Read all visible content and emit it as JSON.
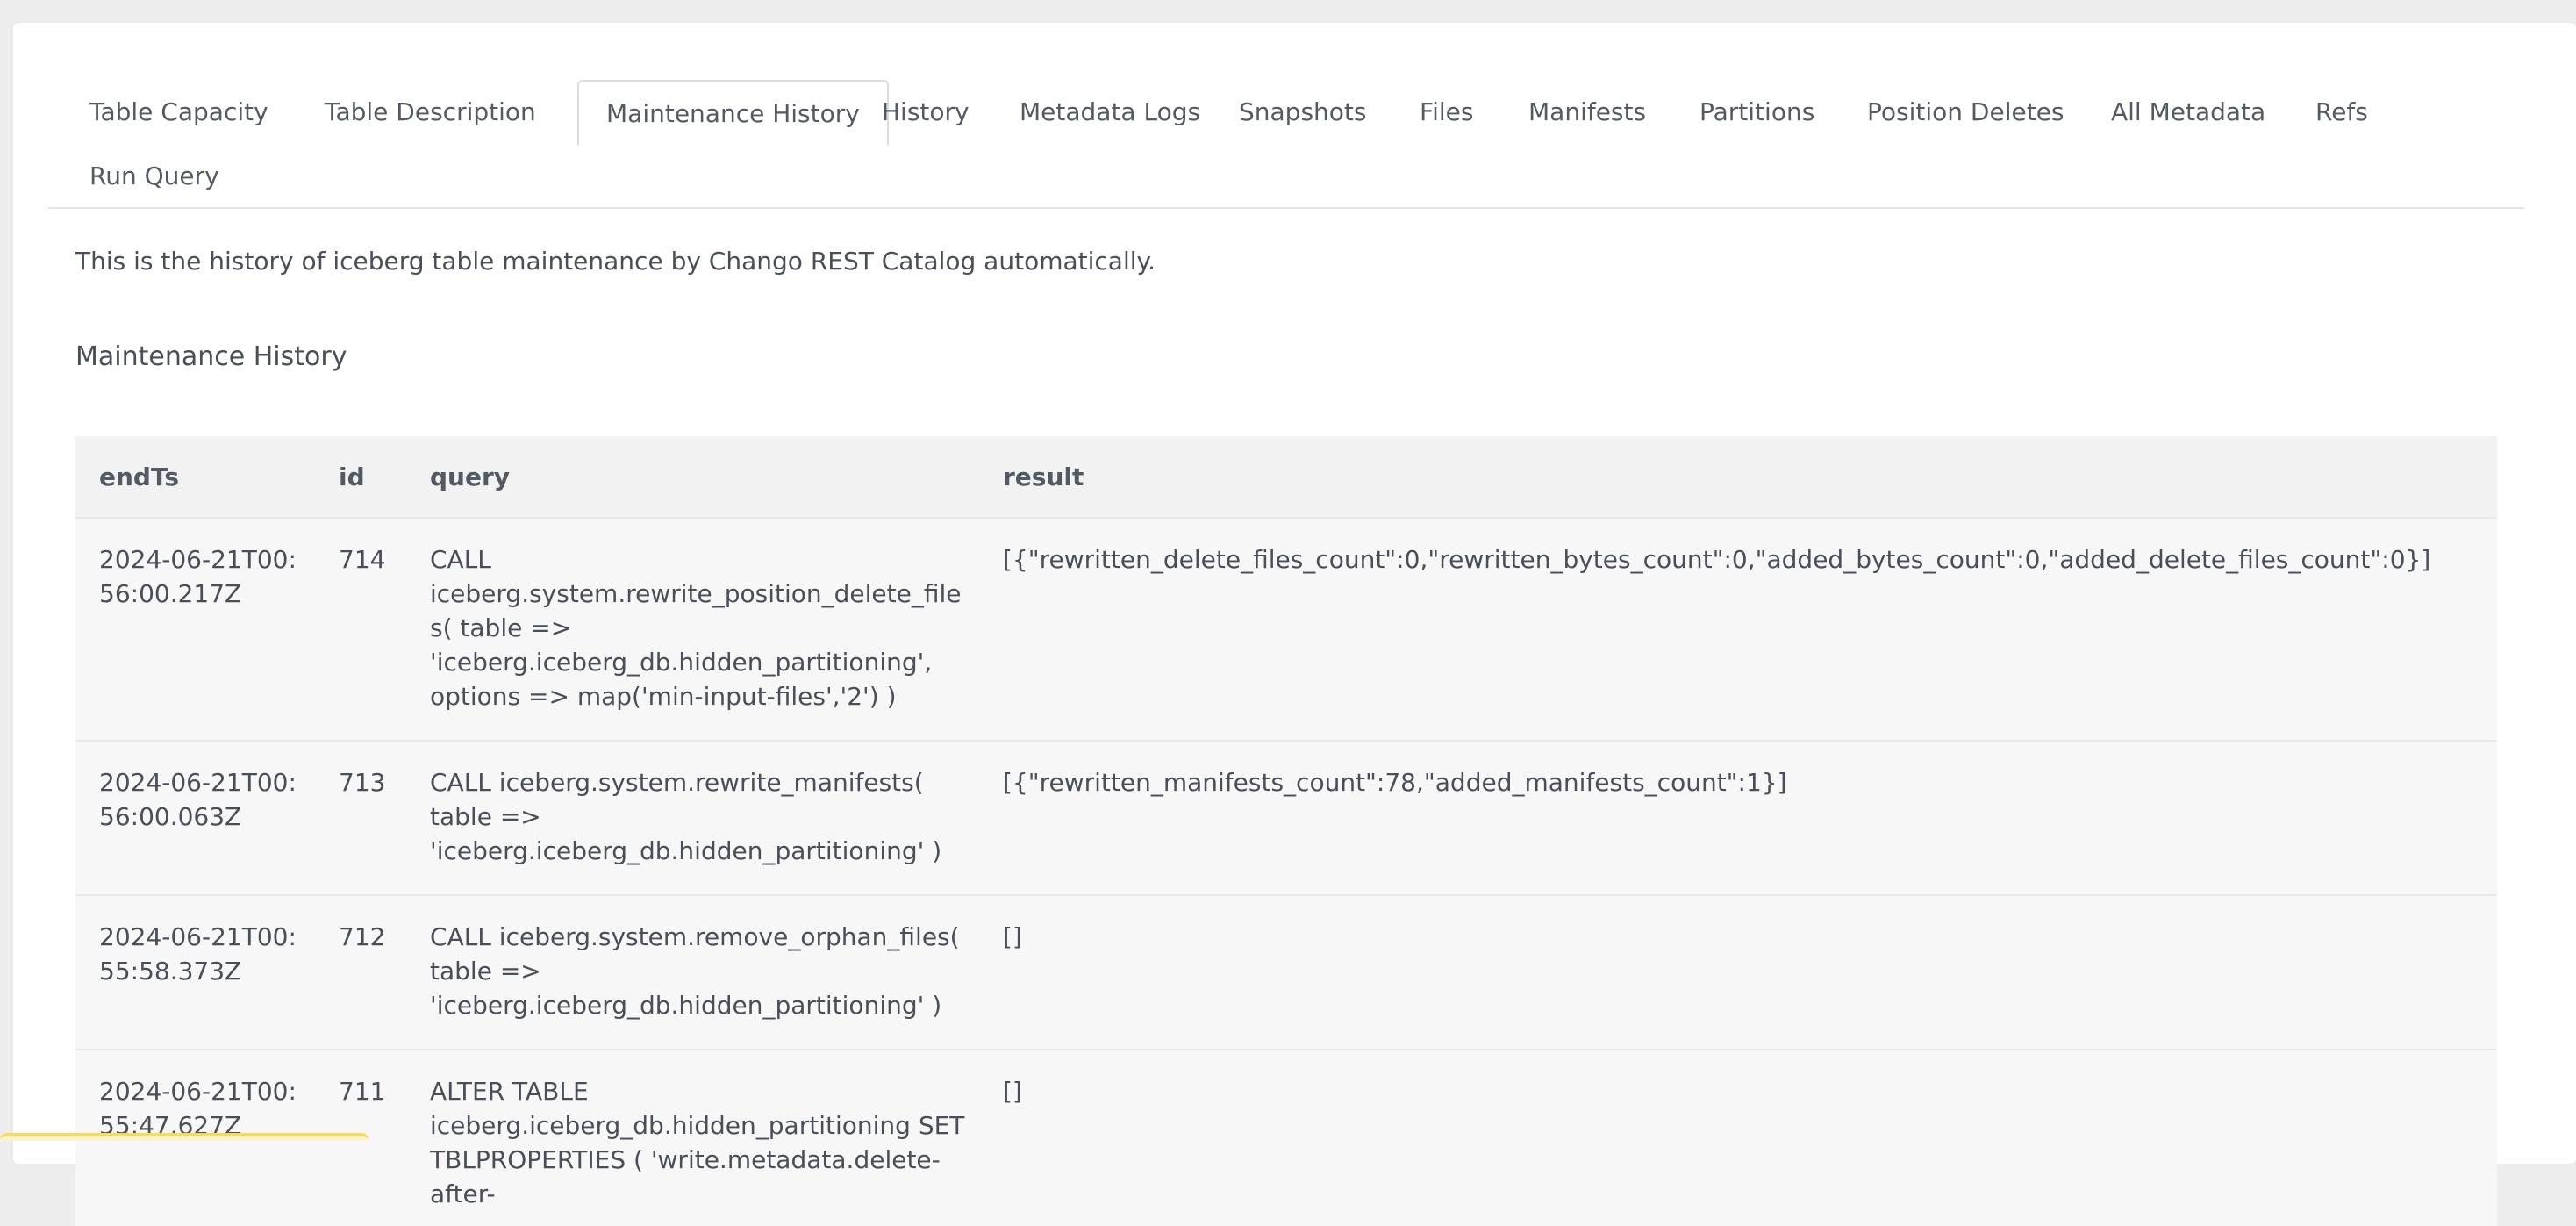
{
  "tabs": [
    {
      "label": "Table Capacity"
    },
    {
      "label": "Table Description"
    },
    {
      "label": "Maintenance History"
    },
    {
      "label": "History"
    },
    {
      "label": "Metadata Logs"
    },
    {
      "label": "Snapshots"
    },
    {
      "label": "Files"
    },
    {
      "label": "Manifests"
    },
    {
      "label": "Partitions"
    },
    {
      "label": "Position Deletes"
    },
    {
      "label": "All Metadata"
    },
    {
      "label": "Refs"
    },
    {
      "label": "Run Query"
    }
  ],
  "active_tab": "Maintenance History",
  "description": "This is the history of iceberg table maintenance by Chango REST Catalog automatically.",
  "section_title": "Maintenance History",
  "table": {
    "columns": [
      "endTs",
      "id",
      "query",
      "result"
    ],
    "rows": [
      {
        "endTs": "2024-06-21T00:56:00.217Z",
        "id": "714",
        "query": "CALL iceberg.system.rewrite_position_delete_files( table => 'iceberg.iceberg_db.hidden_partitioning', options => map('min-input-files','2') )",
        "result": "[{\"rewritten_delete_files_count\":0,\"rewritten_bytes_count\":0,\"added_bytes_count\":0,\"added_delete_files_count\":0}]"
      },
      {
        "endTs": "2024-06-21T00:56:00.063Z",
        "id": "713",
        "query": "CALL iceberg.system.rewrite_manifests( table => 'iceberg.iceberg_db.hidden_partitioning' )",
        "result": "[{\"rewritten_manifests_count\":78,\"added_manifests_count\":1}]"
      },
      {
        "endTs": "2024-06-21T00:55:58.373Z",
        "id": "712",
        "query": "CALL iceberg.system.remove_orphan_files( table => 'iceberg.iceberg_db.hidden_partitioning' )",
        "result": "[]"
      },
      {
        "endTs": "2024-06-21T00:55:47.627Z",
        "id": "711",
        "query": "ALTER TABLE iceberg.iceberg_db.hidden_partitioning SET TBLPROPERTIES ( 'write.metadata.delete-after-",
        "result": "[]"
      }
    ]
  }
}
